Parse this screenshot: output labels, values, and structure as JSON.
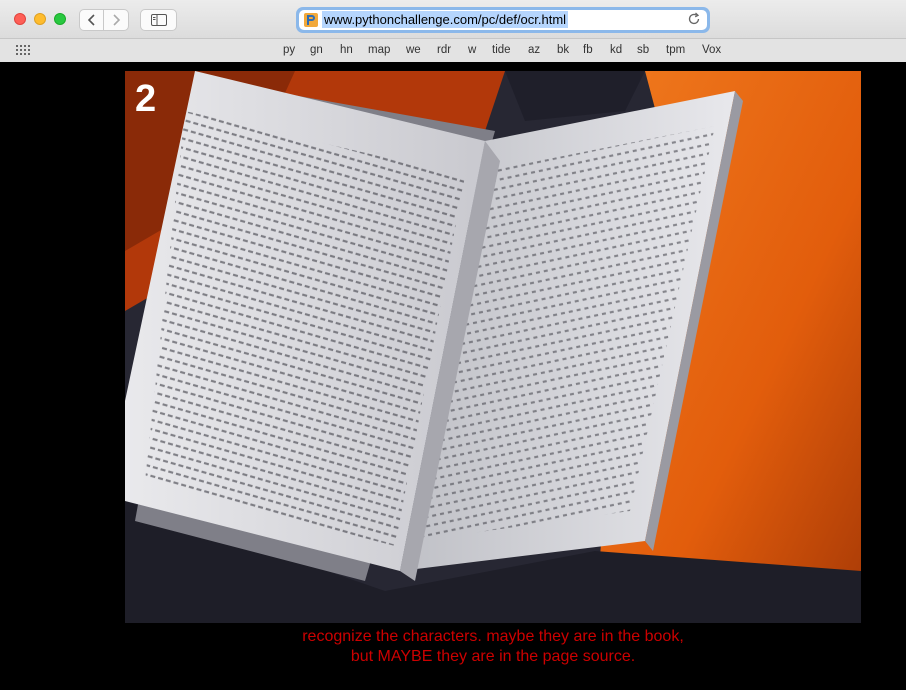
{
  "browser": {
    "url": "www.pythonchallenge.com/pc/def/ocr.html",
    "bookmarks": [
      "py",
      "gn",
      "hn",
      "map",
      "we",
      "rdr",
      "w",
      "tide",
      "az",
      "bk",
      "fb",
      "kd",
      "sb",
      "tpm",
      "Vox"
    ],
    "icons": {
      "close": "close-icon",
      "minimize": "minimize-icon",
      "maximize": "maximize-icon",
      "back": "chevron-left-icon",
      "forward": "chevron-right-icon",
      "sidebar": "sidebar-icon",
      "favicon": "site-favicon-icon",
      "reload": "reload-icon",
      "favorites": "grid-icon"
    }
  },
  "page": {
    "level_number": "2",
    "caption_line1": "recognize the characters. maybe they are in the book,",
    "caption_line2": "but MAYBE they are in the page source.",
    "caption_color": "#cc0000",
    "background": "#000000"
  }
}
